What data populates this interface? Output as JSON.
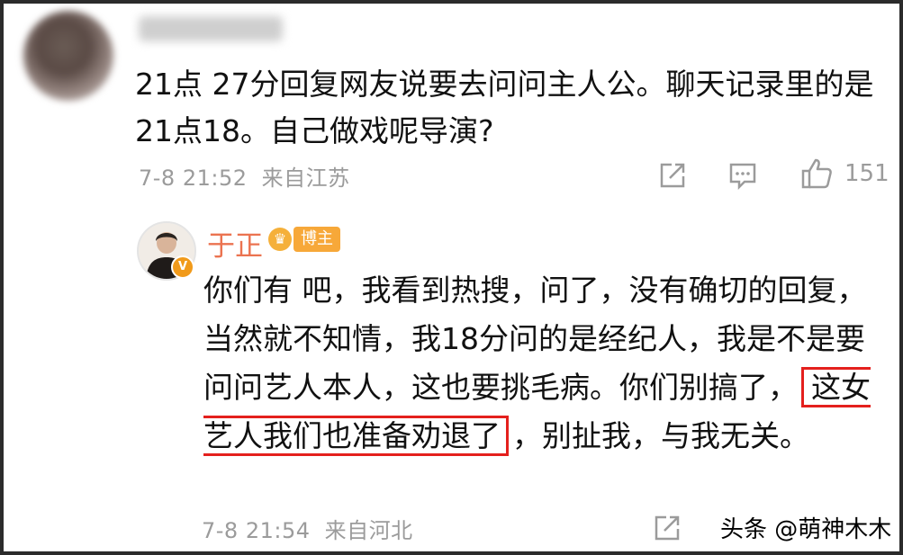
{
  "top_comment": {
    "text": "21点 27分回复网友说要去问问主人公。聊天记录里的是21点18。自己做戏呢导演?",
    "timestamp": "7-8 21:52",
    "location": "来自江苏",
    "like_count": "151"
  },
  "reply": {
    "author": "于正",
    "badge_label": "博主",
    "text_before": "你们有   吧，我看到热搜，问了，没有确切的回复，当然就不知情，我18分问的是经纪人，我是不是要问问艺人本人，这也要挑毛病。你们别搞了，",
    "text_highlight": "这女艺人我们也准备劝退了",
    "text_after": "，别扯我，与我无关。",
    "timestamp": "7-8 21:54",
    "location": "来自河北"
  },
  "watermark": "头条 @萌神木木",
  "colors": {
    "name": "#eb7350",
    "meta": "#9b9b9b",
    "highlight_border": "#e4201d"
  },
  "icons": [
    "share-icon",
    "comment-icon",
    "like-icon",
    "verified-badge-icon",
    "crown-icon"
  ]
}
